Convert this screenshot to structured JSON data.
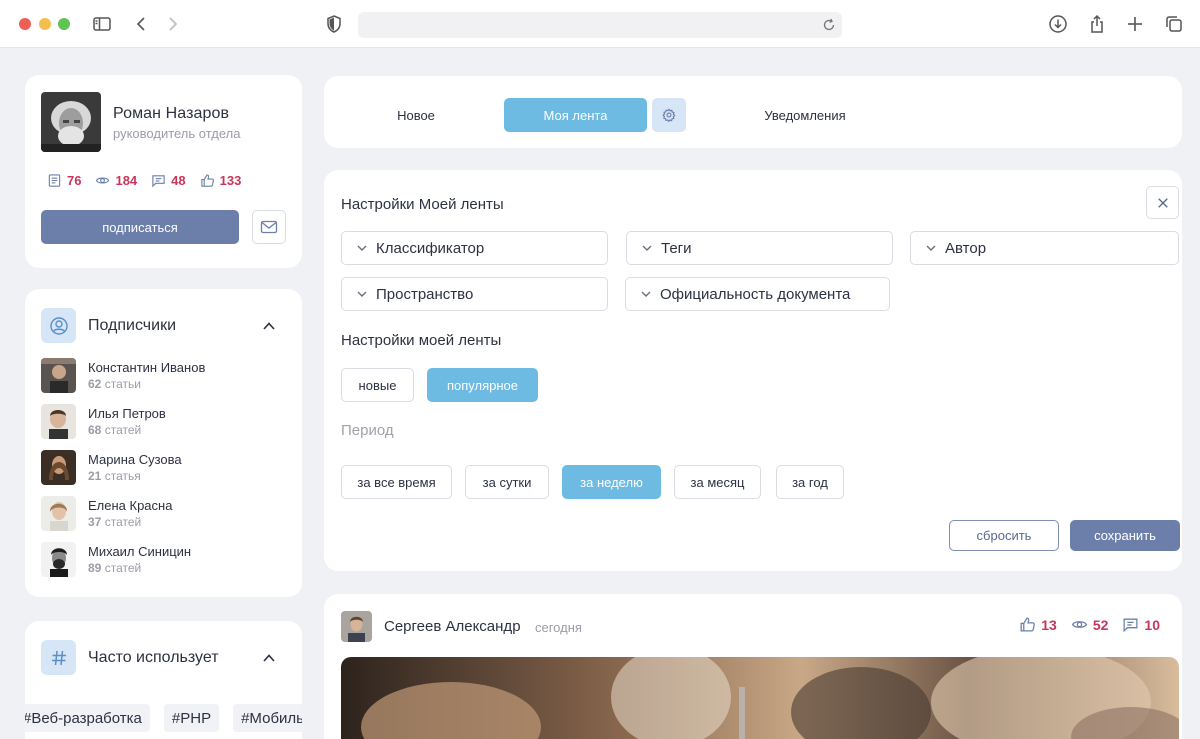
{
  "profile": {
    "name": "Роман Назаров",
    "role": "руководитель отдела",
    "stats": {
      "articles": "76",
      "views": "184",
      "comments": "48",
      "likes": "133"
    },
    "subscribe_label": "подписаться"
  },
  "subscribers": {
    "title": "Подписчики",
    "items": [
      {
        "name": "Константин Иванов",
        "count": "62",
        "unit": "статьи"
      },
      {
        "name": "Илья Петров",
        "count": "68",
        "unit": "статей"
      },
      {
        "name": "Марина Сузова",
        "count": "21",
        "unit": "статья"
      },
      {
        "name": "Елена Красна",
        "count": "37",
        "unit": "статей"
      },
      {
        "name": "Михаил Синицин",
        "count": "89",
        "unit": "статей"
      }
    ]
  },
  "frequent": {
    "title": "Часто использует",
    "tags": [
      "#Веб-разработка",
      "#PHP",
      "#Мобильная разработка"
    ]
  },
  "tabs": {
    "new": "Новое",
    "my_feed": "Моя лента",
    "notifications": "Уведомления"
  },
  "settings": {
    "title": "Настройки Моей ленты",
    "dropdowns": [
      "Классификатор",
      "Теги",
      "Автор",
      "Пространство",
      "Официальность документа"
    ],
    "subtitle": "Настройки моей ленты",
    "sort": {
      "new": "новые",
      "popular": "популярное",
      "selected": "популярное"
    },
    "period_label": "Период",
    "periods": [
      "за все время",
      "за сутки",
      "за неделю",
      "за месяц",
      "за год"
    ],
    "period_selected": "за неделю",
    "reset_label": "сбросить",
    "save_label": "сохранить"
  },
  "post": {
    "author": "Сергеев Александр",
    "time": "сегодня",
    "likes": "13",
    "views": "52",
    "comments": "10"
  },
  "colors": {
    "accent": "#6dbbe3",
    "primary_button": "#6c7fab",
    "counter": "#c8365c",
    "icon_bg": "#d6e6f6"
  },
  "icons": [
    "sidebar-icon",
    "back-icon",
    "forward-icon",
    "shield-icon",
    "reload-icon",
    "download-icon",
    "share-icon",
    "new-tab-icon",
    "tabs-icon",
    "mail-icon",
    "user-icon",
    "hash-icon",
    "gear-icon",
    "close-icon",
    "chevron-down-icon",
    "chevron-up-icon",
    "document-icon",
    "eye-icon",
    "comment-icon",
    "like-icon"
  ]
}
